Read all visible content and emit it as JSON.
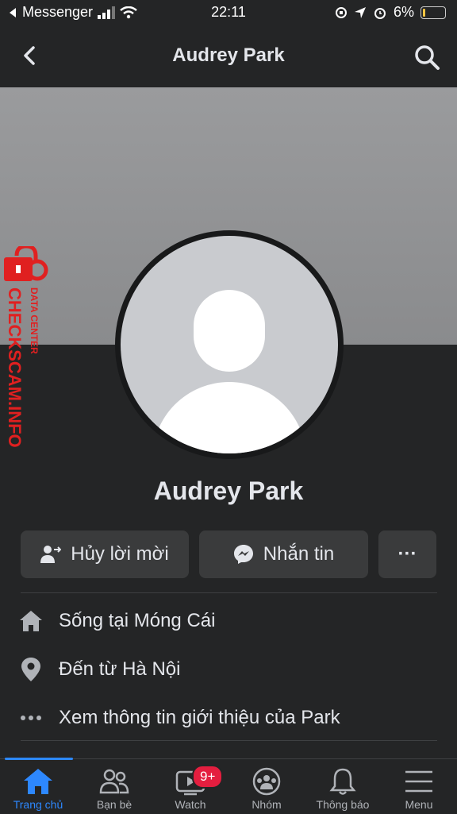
{
  "status_bar": {
    "carrier": "Messenger",
    "time": "22:11",
    "battery": "6%"
  },
  "header": {
    "title": "Audrey Park"
  },
  "profile": {
    "name": "Audrey Park"
  },
  "actions": {
    "cancel_request": "Hủy lời mời",
    "message": "Nhắn tin",
    "more": "···"
  },
  "info": {
    "lives_in": "Sống tại Móng Cái",
    "from": "Đến từ Hà Nội",
    "see_about": "Xem thông tin giới thiệu của Park"
  },
  "watermark": {
    "brand": "CHECKSCAM.INFO",
    "tag": "DATA CENTER"
  },
  "bottom_nav": {
    "home": "Trang chủ",
    "friends": "Bạn bè",
    "watch": "Watch",
    "watch_badge": "9+",
    "groups": "Nhóm",
    "notifications": "Thông báo",
    "menu": "Menu"
  },
  "colors": {
    "accent": "#2d88ff",
    "badge": "#e41e3f",
    "watermark": "#e02020"
  }
}
